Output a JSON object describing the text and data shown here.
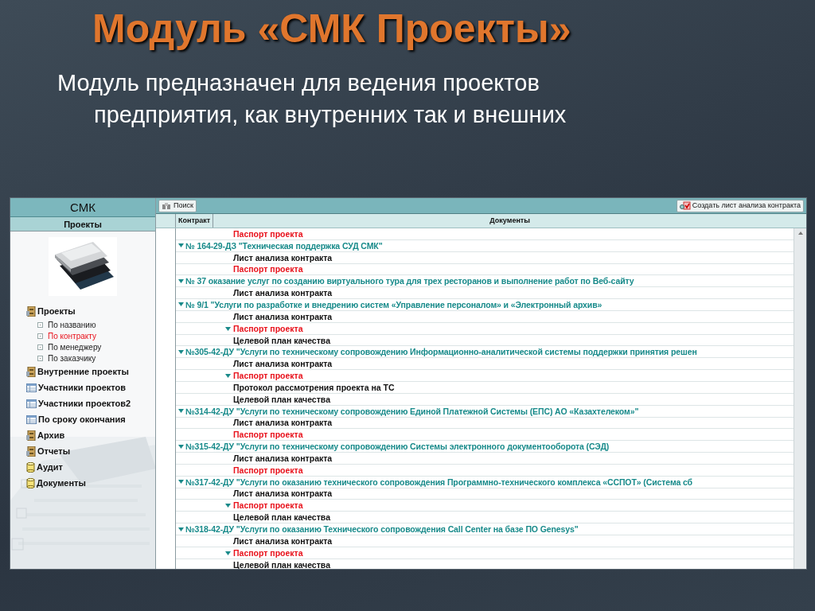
{
  "slide": {
    "title": "Модуль «СМК Проекты»",
    "subtitle_lines": [
      "Модуль предназначен для ведения проектов",
      "предприятия, как внутренних так и внешних"
    ]
  },
  "sidebar": {
    "header": "СМК",
    "section": "Проекты",
    "items": [
      {
        "label": "Проекты",
        "kind": "cabinet",
        "children": [
          {
            "label": "По названию",
            "selected": false
          },
          {
            "label": "По контракту",
            "selected": true
          },
          {
            "label": "По  менеджеру",
            "selected": false
          },
          {
            "label": "По заказчику",
            "selected": false
          }
        ]
      },
      {
        "label": "Внутренние проекты",
        "kind": "cabinet"
      },
      {
        "label": "Участники проектов",
        "kind": "table"
      },
      {
        "label": "Участники проектов2",
        "kind": "table"
      },
      {
        "label": "По сроку окончания",
        "kind": "table"
      },
      {
        "label": "Архив",
        "kind": "cabinet"
      },
      {
        "label": "Отчеты",
        "kind": "cabinet"
      },
      {
        "label": "Аудит",
        "kind": "cylinder"
      },
      {
        "label": "Документы",
        "kind": "cylinder"
      }
    ]
  },
  "toolbar": {
    "search_button": "Поиск",
    "create_button": "Создать лист анализа контракта"
  },
  "table": {
    "columns": [
      "Контракт",
      "Документы"
    ],
    "rows": [
      {
        "kind": "document",
        "text": "Паспорт проекта",
        "highlighted": true,
        "expanded": false
      },
      {
        "kind": "contract",
        "text": "№ 164-29-ДЗ \"Техническая поддержка СУД СМК\"",
        "expanded": true
      },
      {
        "kind": "document",
        "text": "Лист анализа контракта",
        "highlighted": false,
        "expanded": false
      },
      {
        "kind": "document",
        "text": "Паспорт проекта",
        "highlighted": true,
        "expanded": false
      },
      {
        "kind": "contract",
        "text": "№ 37 оказание услуг по созданию виртуального тура для трех ресторанов и выполнение работ по Веб-сайту",
        "expanded": true
      },
      {
        "kind": "document",
        "text": "Лист анализа контракта",
        "highlighted": false,
        "expanded": false
      },
      {
        "kind": "contract",
        "text": "№ 9/1  \"Услуги по разработке и внедрению систем «Управление персоналом» и «Электронный архив»",
        "expanded": true
      },
      {
        "kind": "document",
        "text": "Лист анализа контракта",
        "highlighted": false,
        "expanded": false
      },
      {
        "kind": "document",
        "text": "Паспорт проекта",
        "highlighted": true,
        "expanded": true
      },
      {
        "kind": "document",
        "text": "Целевой план качества",
        "highlighted": false,
        "expanded": false
      },
      {
        "kind": "contract",
        "text": "№305-42-ДУ \"Услуги по техническому сопровождению Информационно-аналитической  системы поддержки принятия решен",
        "expanded": true
      },
      {
        "kind": "document",
        "text": "Лист анализа контракта",
        "highlighted": false,
        "expanded": false
      },
      {
        "kind": "document",
        "text": "Паспорт проекта",
        "highlighted": true,
        "expanded": true
      },
      {
        "kind": "document",
        "text": "Протокол рассмотрения проекта на ТС",
        "highlighted": false,
        "expanded": false
      },
      {
        "kind": "document",
        "text": "Целевой план качества",
        "highlighted": false,
        "expanded": false
      },
      {
        "kind": "contract",
        "text": "№314-42-ДУ \"Услуги по техническому сопровождению Единой Платежной Системы (ЕПС) АО «Казахтелеком»\"",
        "expanded": true
      },
      {
        "kind": "document",
        "text": "Лист анализа контракта",
        "highlighted": false,
        "expanded": false
      },
      {
        "kind": "document",
        "text": "Паспорт проекта",
        "highlighted": true,
        "expanded": false
      },
      {
        "kind": "contract",
        "text": "№315-42-ДУ \"Услуги по техническому сопровождению Системы электронного документооборота (СЭД)",
        "expanded": true
      },
      {
        "kind": "document",
        "text": "Лист анализа контракта",
        "highlighted": false,
        "expanded": false
      },
      {
        "kind": "document",
        "text": "Паспорт проекта",
        "highlighted": true,
        "expanded": false
      },
      {
        "kind": "contract",
        "text": "№317-42-ДУ \"Услуги по оказанию технического сопровождения Программно-технического комплекса «ССПОТ» (Система сб",
        "expanded": true
      },
      {
        "kind": "document",
        "text": "Лист анализа контракта",
        "highlighted": false,
        "expanded": false
      },
      {
        "kind": "document",
        "text": "Паспорт проекта",
        "highlighted": true,
        "expanded": true
      },
      {
        "kind": "document",
        "text": "Целевой план качества",
        "highlighted": false,
        "expanded": false
      },
      {
        "kind": "contract",
        "text": "№318-42-ДУ \"Услуги по оказанию Технического сопровождения Call Center на базе ПО Genesys\"",
        "expanded": true
      },
      {
        "kind": "document",
        "text": "Лист анализа контракта",
        "highlighted": false,
        "expanded": false
      },
      {
        "kind": "document",
        "text": "Паспорт проекта",
        "highlighted": true,
        "expanded": true
      },
      {
        "kind": "document",
        "text": "Целевой план качества",
        "highlighted": false,
        "expanded": false
      }
    ]
  }
}
